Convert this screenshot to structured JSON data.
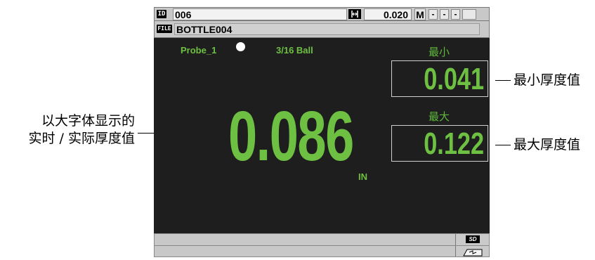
{
  "header": {
    "id_tag": "ID",
    "id_value": "006",
    "measure_value": "0.020",
    "mode_letter": "M",
    "mode_slots": [
      "-",
      "-",
      "-"
    ],
    "file_tag": "FILE",
    "file_value": "BOTTLE004"
  },
  "probe": {
    "name": "Probe_1",
    "ball_size": "3/16 Ball"
  },
  "reading": {
    "value": "0.086",
    "unit": "IN"
  },
  "min": {
    "label": "最小",
    "value": "0.041"
  },
  "max": {
    "label": "最大",
    "value": "0.122"
  },
  "status": {
    "sd_icon_text": "SD"
  },
  "annotations": {
    "left_line1": "以大字体显示的",
    "left_line2": "实时 / 实际厚度值",
    "min_callout": "最小厚度值",
    "max_callout": "最大厚度值"
  },
  "colors": {
    "screen_bg": "#1e1e1e",
    "reading_green": "#6ec043",
    "bar_gray": "#c8c8c8"
  }
}
